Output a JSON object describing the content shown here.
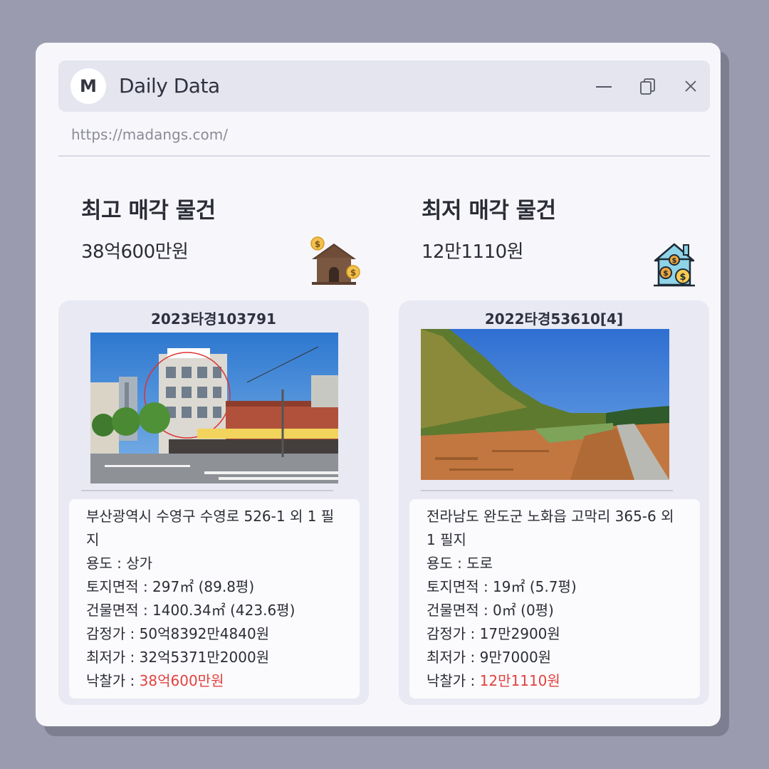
{
  "window": {
    "logo_letter": "M",
    "title": "Daily Data",
    "url": "https://madangs.com/"
  },
  "highest": {
    "label": "최고 매각 물건",
    "price": "38억600만원",
    "icon": "house-money-icon",
    "case_no": "2023타경103791",
    "address": "부산광역시 수영구 수영로 526-1 외 1 필지",
    "usage": "용도 : 상가",
    "land_area": "토지면적 : 297㎡ (89.8평)",
    "building_area": "건물면적 : 1400.34㎡ (423.6평)",
    "appraisal": "감정가 : 50억8392만4840원",
    "minimum": "최저가 : 32억5371만2000원",
    "winning_label": "낙찰가 : ",
    "winning_value": "38억600만원"
  },
  "lowest": {
    "label": "최저 매각 물건",
    "price": "12만1110원",
    "icon": "house-coins-icon",
    "case_no": "2022타경53610[4]",
    "address": "전라남도 완도군 노화읍 고막리 365-6 외 1 필지",
    "usage": "용도 : 도로",
    "land_area": "토지면적 : 19㎡ (5.7평)",
    "building_area": "건물면적 : 0㎡ (0평)",
    "appraisal": "감정가 : 17만2900원",
    "minimum": "최저가 : 9만7000원",
    "winning_label": "낙찰가 : ",
    "winning_value": "12만1110원"
  },
  "colors": {
    "accent_red": "#e2423f",
    "background": "#9a9bae",
    "window": "#f7f7fb",
    "card": "#e8e9f3"
  }
}
